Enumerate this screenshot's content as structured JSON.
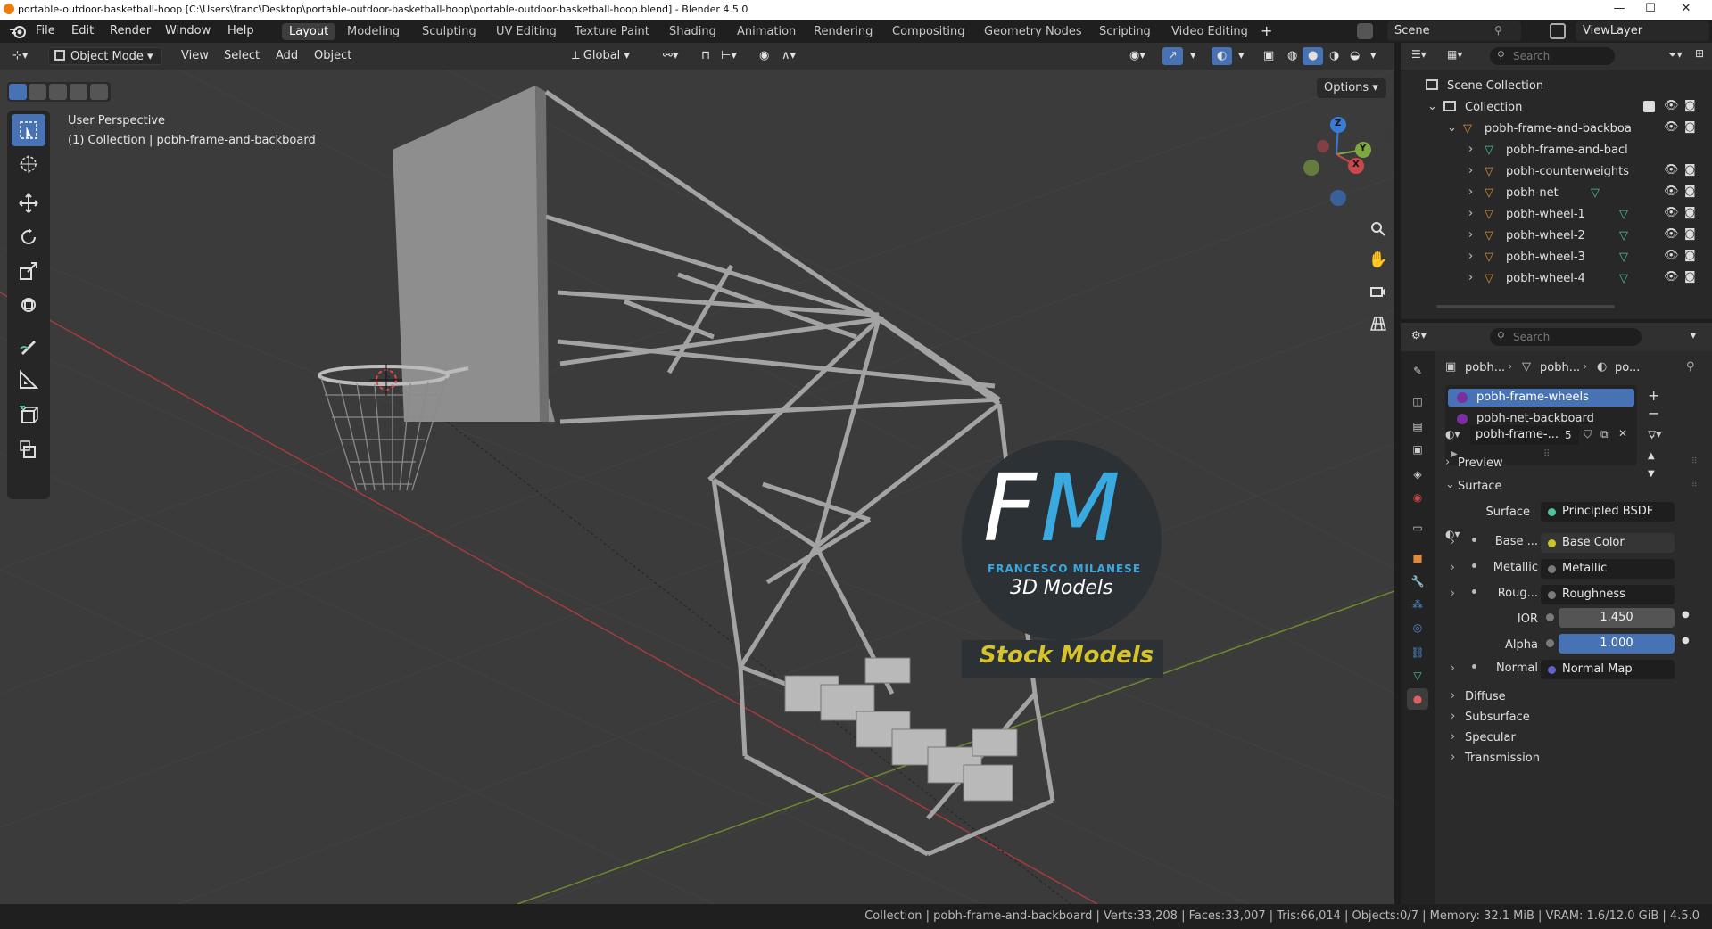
{
  "titlebar": {
    "title": "portable-outdoor-basketball-hoop [C:\\Users\\franc\\Desktop\\portable-outdoor-basketball-hoop\\portable-outdoor-basketball-hoop.blend] - Blender 4.5.0",
    "min": "—",
    "max": "☐",
    "close": "✕"
  },
  "menu": {
    "items": [
      "File",
      "Edit",
      "Render",
      "Window",
      "Help"
    ]
  },
  "workspaces": [
    "Layout",
    "Modeling",
    "Sculpting",
    "UV Editing",
    "Texture Paint",
    "Shading",
    "Animation",
    "Rendering",
    "Compositing",
    "Geometry Nodes",
    "Scripting",
    "Video Editing"
  ],
  "workspace_add": "+",
  "scene": {
    "label": "Scene",
    "viewlayer": "ViewLayer"
  },
  "viewport_header": {
    "mode": "Object Mode",
    "menus": [
      "View",
      "Select",
      "Add",
      "Object"
    ],
    "orientation": "Global",
    "options": "Options"
  },
  "viewport": {
    "perspective": "User Perspective",
    "collection_info": "(1) Collection | pobh-frame-and-backboard",
    "gizmo": {
      "z": "Z",
      "y": "Y",
      "x": "X"
    },
    "watermark": {
      "initials_f": "F",
      "initials_m": "M",
      "name": "FRANCESCO MILANESE",
      "sub": "3D Models",
      "tag": "Stock Models"
    }
  },
  "outliner": {
    "search_placeholder": "Search",
    "scene_collection": "Scene Collection",
    "collection": "Collection",
    "parent": "pobh-frame-and-backboa",
    "children": [
      "pobh-frame-and-bacl",
      "pobh-counterweights",
      "pobh-net",
      "pobh-wheel-1",
      "pobh-wheel-2",
      "pobh-wheel-3",
      "pobh-wheel-4"
    ]
  },
  "properties": {
    "search_placeholder": "Search",
    "breadcrumb": [
      "pobh...",
      "pobh...",
      "po..."
    ],
    "material_slots": [
      "pobh-frame-wheels",
      "pobh-net-backboard"
    ],
    "material_name": "pobh-frame-...",
    "material_users": "5",
    "sections": {
      "preview": "Preview",
      "surface": "Surface"
    },
    "surface_label": "Surface",
    "surface_value": "Principled BSDF",
    "inputs": [
      {
        "label": "Base ...",
        "value": "Base Color",
        "color": "#c7c729"
      },
      {
        "label": "Metallic",
        "value": "Metallic",
        "color": "#7a7a7a"
      },
      {
        "label": "Roug...",
        "value": "Roughness",
        "color": "#7a7a7a"
      }
    ],
    "ior": {
      "label": "IOR",
      "value": "1.450"
    },
    "alpha": {
      "label": "Alpha",
      "value": "1.000"
    },
    "normal": {
      "label": "Normal",
      "value": "Normal Map",
      "color": "#6363c7"
    },
    "subpanels": [
      "Diffuse",
      "Subsurface",
      "Specular",
      "Transmission"
    ]
  },
  "statusbar": {
    "text": "Collection | pobh-frame-and-backboard | Verts:33,208 | Faces:33,007 | Tris:66,014 | Objects:0/7 | Memory: 32.1 MiB | VRAM: 1.6/12.0 GiB | 4.5.0"
  },
  "colors": {
    "accent": "#4772b3",
    "object_orange": "#e08a3c",
    "mesh_green": "#4fc29b",
    "axis_red": "#c8484d",
    "axis_green": "#80a840"
  }
}
